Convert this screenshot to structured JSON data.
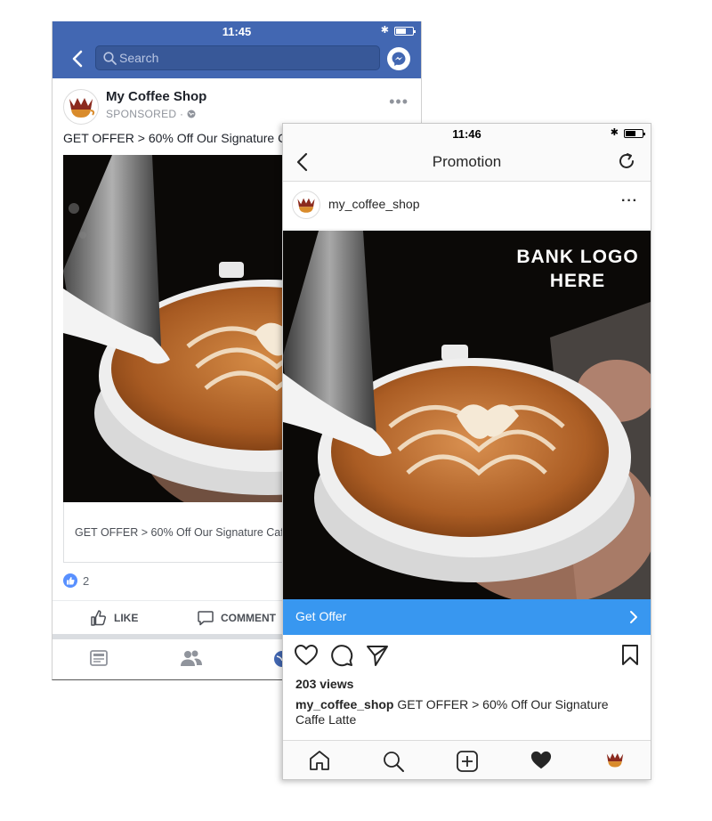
{
  "facebook": {
    "status_time": "11:45",
    "search_placeholder": "Search",
    "page_name": "My Coffee Shop",
    "sponsored_label": "SPONSORED",
    "sponsored_separator": "·",
    "post_text": "GET OFFER > 60% Off Our Signature C",
    "link_text": "GET OFFER > 60% Off Our Signature Caff",
    "like_count": "2",
    "like_label": "LIKE",
    "comment_label": "COMMENT",
    "colors": {
      "brand": "#4267b2",
      "like_badge": "#5890ff"
    },
    "icons": [
      "back-icon",
      "search-icon",
      "messenger-icon",
      "globe-icon",
      "thumbs-up-icon",
      "comment-icon",
      "news-feed-icon",
      "friends-icon"
    ]
  },
  "instagram": {
    "status_time": "11:46",
    "header_title": "Promotion",
    "username": "my_coffee_shop",
    "overlay_text": "BANK LOGO\nHERE",
    "cta_label": "Get Offer",
    "views": "203 views",
    "caption_user": "my_coffee_shop",
    "caption_text": " GET OFFER > 60% Off Our Signature Caffe Latte",
    "colors": {
      "cta": "#3897f0"
    },
    "icons": [
      "back-icon",
      "refresh-icon",
      "heart-icon",
      "comment-icon",
      "send-icon",
      "bookmark-icon",
      "home-icon",
      "search-icon",
      "add-icon",
      "activity-heart-icon"
    ]
  }
}
